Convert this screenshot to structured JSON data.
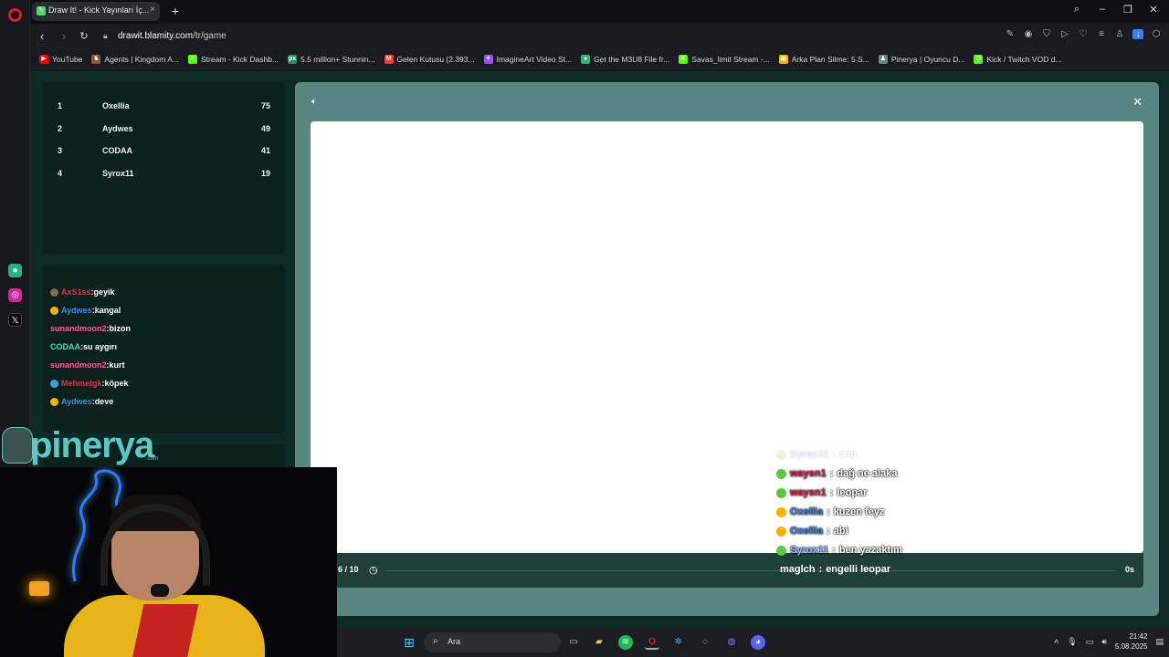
{
  "browser": {
    "tab_title": "Draw It! - Kick Yayınları İç...",
    "url_host": "drawit.blamity.com",
    "url_path": "/tr/game",
    "bookmarks": [
      {
        "label": "YouTube",
        "color": "#ff0000",
        "glyph": "▶"
      },
      {
        "label": "Agents | Kingdom A...",
        "color": "#8a5a3c",
        "glyph": "♞"
      },
      {
        "label": "Stream - Kick Dashb...",
        "color": "#53fc18",
        "glyph": "K"
      },
      {
        "label": "5.5 million+ Stunnin...",
        "color": "#1f8f5f",
        "glyph": "px"
      },
      {
        "label": "Gelen Kutusu (2.393...",
        "color": "#ea4335",
        "glyph": "M"
      },
      {
        "label": "ImagineArt Video St...",
        "color": "#9b4dff",
        "glyph": "✦"
      },
      {
        "label": "Get the M3U8 File fr...",
        "color": "#2bb673",
        "glyph": "●"
      },
      {
        "label": "Savas_limit Stream -...",
        "color": "#53fc18",
        "glyph": "K"
      },
      {
        "label": "Arka Plan Silme: 5 S...",
        "color": "#f5b400",
        "glyph": "▣"
      },
      {
        "label": "Pinerya | Oyuncu D...",
        "color": "#6a8a87",
        "glyph": "♟"
      },
      {
        "label": "Kick / Twitch VOD d...",
        "color": "#53fc18",
        "glyph": "D"
      }
    ]
  },
  "leaderboard": [
    {
      "rank": "1",
      "name": "Oxellia",
      "score": "75"
    },
    {
      "rank": "2",
      "name": "Aydwes",
      "score": "49"
    },
    {
      "rank": "3",
      "name": "CODAA",
      "score": "41"
    },
    {
      "rank": "4",
      "name": "Syrox11",
      "score": "19"
    }
  ],
  "chat": [
    {
      "user": "AxS1ss",
      "message": "geyik",
      "color": "#e0334b"
    },
    {
      "user": "Aydwes",
      "message": "kangal",
      "color": "#3c8ee0"
    },
    {
      "user": "sunandmoon2",
      "message": "bizon",
      "color": "#ff5a9a"
    },
    {
      "user": "CODAA",
      "message": "su aygırı",
      "color": "#3fe0b0"
    },
    {
      "user": "sunandmoon2",
      "message": "kurt",
      "color": "#ff5a9a"
    },
    {
      "user": "Mehmetgk",
      "message": "köpek",
      "color": "#e0334b"
    },
    {
      "user": "Aydwes",
      "message": "deve",
      "color": "#3c8ee0"
    }
  ],
  "game": {
    "round": "6 / 10",
    "seconds": "0s",
    "progress": 0
  },
  "overlay_chat": [
    {
      "user": "Syrox11",
      "message": "sap",
      "color": "#8fb5ff",
      "faded": true
    },
    {
      "user": "waysn1",
      "message": "dağ ne alaka",
      "color": "#d0284a"
    },
    {
      "user": "waysn1",
      "message": "leopar",
      "color": "#d0284a"
    },
    {
      "user": "Oxellia",
      "message": "kuzen feyz",
      "color": "#3c7fe0"
    },
    {
      "user": "Oxellia",
      "message": "abi",
      "color": "#3c7fe0"
    },
    {
      "user": "Syrox11",
      "message": "ben yazaktım",
      "color": "#8fb5ff"
    },
    {
      "user": "maglch",
      "message": "engelli leopar",
      "color": "#ffffff"
    }
  ],
  "branding": {
    "logo_text": "pinerya",
    "logo_sub": ".com"
  },
  "taskbar": {
    "search_text": "Ara",
    "time": "21:42",
    "date": "5.08.2025"
  },
  "colors": {
    "accent_teal": "#5fc7c3",
    "page_bg": "#0d2a26",
    "panel_bg": "#0a211e",
    "game_bg": "#588580"
  }
}
